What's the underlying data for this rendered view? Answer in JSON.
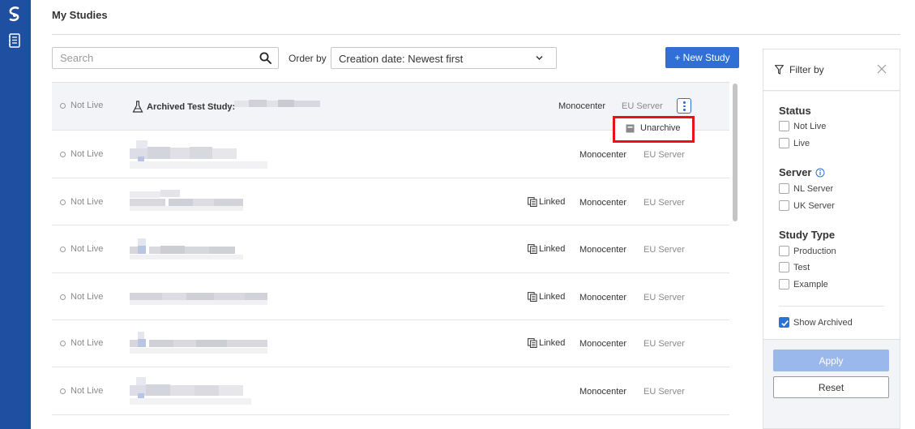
{
  "page": {
    "title": "My Studies"
  },
  "toolbar": {
    "search_placeholder": "Search",
    "order_label": "Order by",
    "order_value": "Creation date: Newest first",
    "new_study_label": "+ New Study"
  },
  "rows": [
    {
      "status": "Not Live",
      "name_prefix": "Archived Test Study:",
      "linked": "",
      "center": "Monocenter",
      "server": "EU Server",
      "archived": true
    },
    {
      "status": "Not Live",
      "linked": "",
      "center": "Monocenter",
      "server": "EU Server"
    },
    {
      "status": "Not Live",
      "linked": "Linked",
      "center": "Monocenter",
      "server": "EU Server"
    },
    {
      "status": "Not Live",
      "linked": "Linked",
      "center": "Monocenter",
      "server": "EU Server"
    },
    {
      "status": "Not Live",
      "linked": "Linked",
      "center": "Monocenter",
      "server": "EU Server"
    },
    {
      "status": "Not Live",
      "linked": "Linked",
      "center": "Monocenter",
      "server": "EU Server"
    },
    {
      "status": "Not Live",
      "linked": "",
      "center": "Monocenter",
      "server": "EU Server"
    }
  ],
  "row_menu": {
    "unarchive_label": "Unarchive"
  },
  "filter": {
    "title": "Filter by",
    "status": {
      "title": "Status",
      "options": [
        "Not Live",
        "Live"
      ]
    },
    "server": {
      "title": "Server",
      "options": [
        "NL Server",
        "UK Server"
      ]
    },
    "study_type": {
      "title": "Study Type",
      "options": [
        "Production",
        "Test",
        "Example"
      ]
    },
    "show_archived": {
      "label": "Show Archived",
      "checked": true
    },
    "apply_label": "Apply",
    "reset_label": "Reset"
  },
  "colors": {
    "sidebar": "#1f4fa0",
    "accent": "#2f6fd6",
    "highlight_box": "#e8121a",
    "apply_disabled": "#9ab8ec"
  }
}
